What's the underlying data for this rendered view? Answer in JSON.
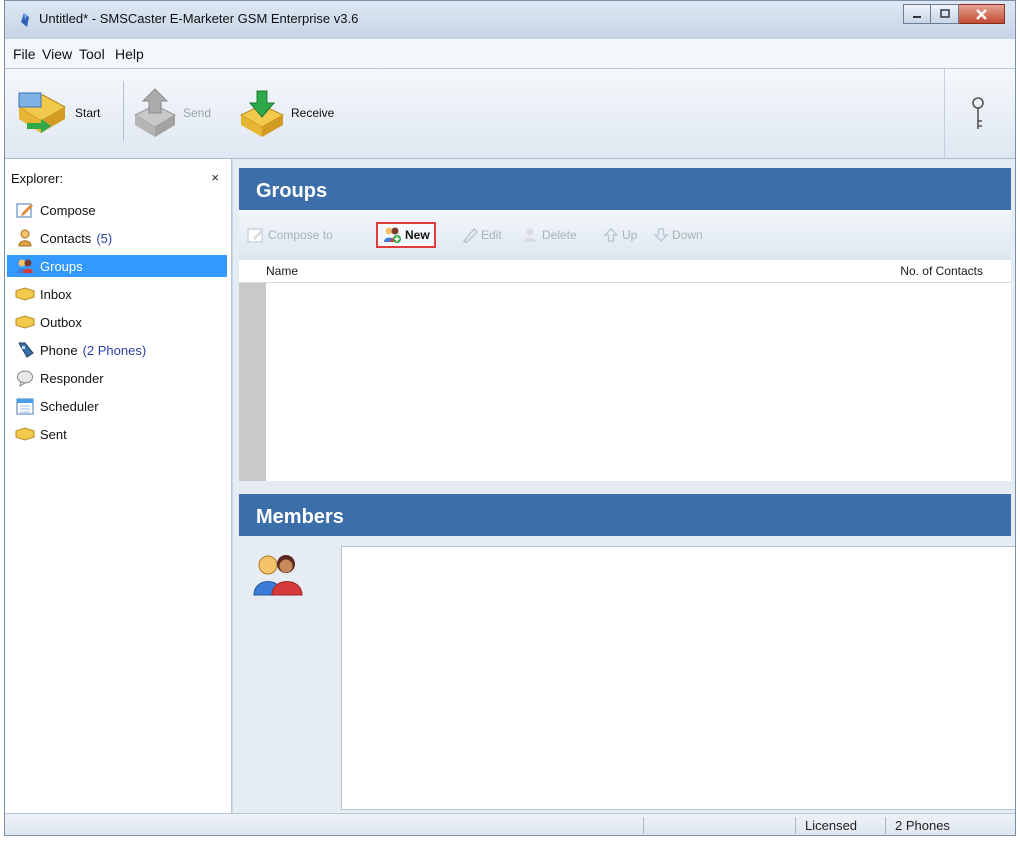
{
  "window": {
    "title": "Untitled* - SMSCaster E-Marketer GSM Enterprise v3.6",
    "icons": {
      "app": "app-icon",
      "minimize": "minimize-icon",
      "maximize": "maximize-icon",
      "close": "close-icon"
    }
  },
  "menu": {
    "items": [
      "File",
      "View",
      "Tool",
      "Help"
    ]
  },
  "toolbar": {
    "start_label": "Start",
    "send_label": "Send",
    "receive_label": "Receive",
    "key_icon": "key-icon"
  },
  "explorer": {
    "header": "Explorer:",
    "close_glyph": "×",
    "items": [
      {
        "label": "Compose",
        "count": "",
        "icon": "compose-icon"
      },
      {
        "label": "Contacts",
        "count": "(5)",
        "icon": "contacts-icon"
      },
      {
        "label": "Groups",
        "count": "",
        "icon": "groups-icon",
        "selected": true
      },
      {
        "label": "Inbox",
        "count": "",
        "icon": "inbox-icon"
      },
      {
        "label": "Outbox",
        "count": "",
        "icon": "outbox-icon"
      },
      {
        "label": "Phone",
        "count": "(2 Phones)",
        "icon": "phone-icon"
      },
      {
        "label": "Responder",
        "count": "",
        "icon": "responder-icon"
      },
      {
        "label": "Scheduler",
        "count": "",
        "icon": "scheduler-icon"
      },
      {
        "label": "Sent",
        "count": "",
        "icon": "sent-icon"
      }
    ]
  },
  "groups": {
    "title": "Groups",
    "toolbar": {
      "compose_to": "Compose to",
      "new": "New",
      "edit": "Edit",
      "delete": "Delete",
      "up": "Up",
      "down": "Down"
    },
    "columns": {
      "name": "Name",
      "count": "No. of Contacts"
    },
    "rows": []
  },
  "members": {
    "title": "Members",
    "icon": "members-icon"
  },
  "status": {
    "license": "Licensed",
    "phones": "2 Phones"
  },
  "colors": {
    "band": "#3c6fa9",
    "selected": "#3399ff",
    "highlight_border": "#e03c3c",
    "count_text": "#2b3fa8"
  }
}
